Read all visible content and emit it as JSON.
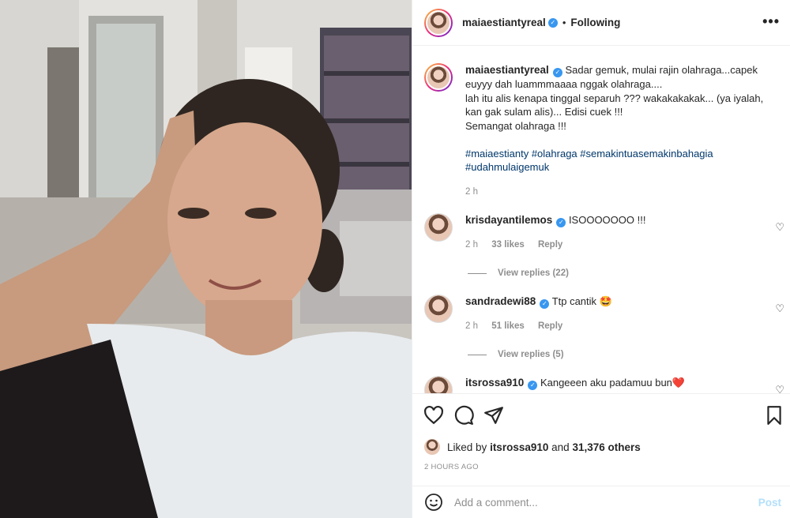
{
  "header": {
    "username": "maiaestiantyreal",
    "separator": "•",
    "follow_status": "Following",
    "more": "•••"
  },
  "caption": {
    "username": "maiaestiantyreal",
    "text": "Sadar gemuk, mulai rajin olahraga...capek euyyy dah luammmaaaa nggak olahraga....",
    "line2": "lah itu alis kenapa tinggal separuh ??? wakakakakak... (ya iyalah, kan gak sulam alis)... Edisi cuek !!!",
    "line3": "Semangat olahraga !!!",
    "hashtags": "#maiaestianty #olahraga #semakintuasemakinbahagia #udahmulaigemuk",
    "time": "2 h"
  },
  "comments": [
    {
      "username": "krisdayantilemos",
      "text": "ISOOOOOOO !!!",
      "time": "2 h",
      "likes": "33 likes",
      "reply": "Reply",
      "view_replies": "View replies (22)"
    },
    {
      "username": "sandradewi88",
      "text": "Ttp cantik 🤩",
      "time": "2 h",
      "likes": "51 likes",
      "reply": "Reply",
      "view_replies": "View replies (5)"
    },
    {
      "username": "itsrossa910",
      "text": "Kangeeen aku padamuu bun❤️"
    }
  ],
  "likes": {
    "prefix": "Liked by",
    "user": "itsrossa910",
    "and": "and",
    "others": "31,376 others"
  },
  "timestamp": "2 HOURS AGO",
  "comment_box": {
    "placeholder": "Add a comment...",
    "post_label": "Post"
  },
  "colors": {
    "verified": "#3897f0",
    "hashtag": "#00376b",
    "muted": "#8e8e8e",
    "post_disabled": "#b2dffc"
  }
}
